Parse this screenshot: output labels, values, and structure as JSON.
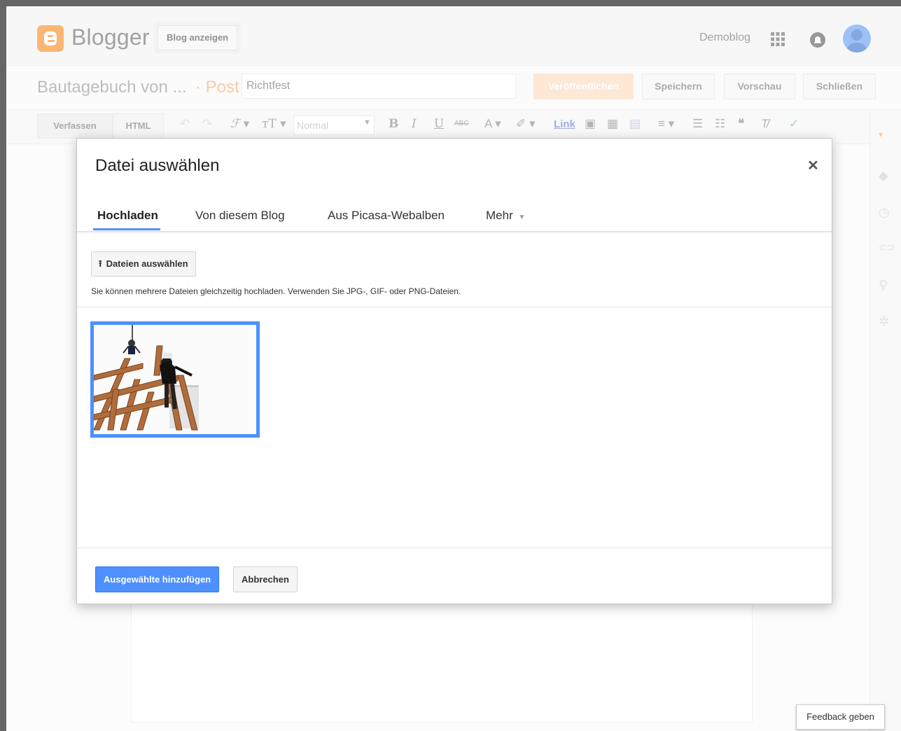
{
  "header": {
    "app_name": "Blogger",
    "view_blog_label": "Blog anzeigen",
    "blog_switcher": "Demoblog"
  },
  "post_bar": {
    "blog_title": "Bautagebuch von ...",
    "separator_label": "· Post",
    "post_title_value": "Richtfest",
    "publish_label": "Veröffentlichen",
    "save_label": "Speichern",
    "preview_label": "Vorschau",
    "close_label": "Schließen"
  },
  "toolbar": {
    "compose_tab": "Verfassen",
    "html_tab": "HTML",
    "format_value": "Normal",
    "link_label": "Link",
    "icons": [
      "undo-icon",
      "redo-icon",
      "font-icon",
      "font-size-icon",
      "bold-icon",
      "italic-icon",
      "underline-icon",
      "strikethrough-icon",
      "text-color-icon",
      "highlight-icon",
      "image-icon",
      "video-icon",
      "jump-break-icon",
      "align-icon",
      "numbered-list-icon",
      "bulleted-list-icon",
      "quote-icon",
      "clear-format-icon",
      "spellcheck-icon"
    ]
  },
  "right_sidebar": {
    "icons": [
      "labels-icon",
      "schedule-icon",
      "permalink-icon",
      "location-icon",
      "options-icon"
    ]
  },
  "dialog": {
    "title": "Datei auswählen",
    "tabs": [
      {
        "label": "Hochladen",
        "active": true
      },
      {
        "label": "Von diesem Blog",
        "active": false
      },
      {
        "label": "Aus Picasa-Webalben",
        "active": false
      },
      {
        "label": "Mehr",
        "active": false
      }
    ],
    "choose_files_label": "Dateien auswählen",
    "hint_text": "Sie können mehrere Dateien gleichzeitig hochladen. Verwenden Sie JPG-, GIF- oder PNG-Dateien.",
    "add_selected_label": "Ausgewählte hinzufügen",
    "cancel_label": "Abbrechen"
  },
  "feedback_label": "Feedback geben",
  "colors": {
    "accent": "#4d90fe",
    "blogger_orange": "#f57d00",
    "publish_disabled": "#fbd3b3"
  }
}
